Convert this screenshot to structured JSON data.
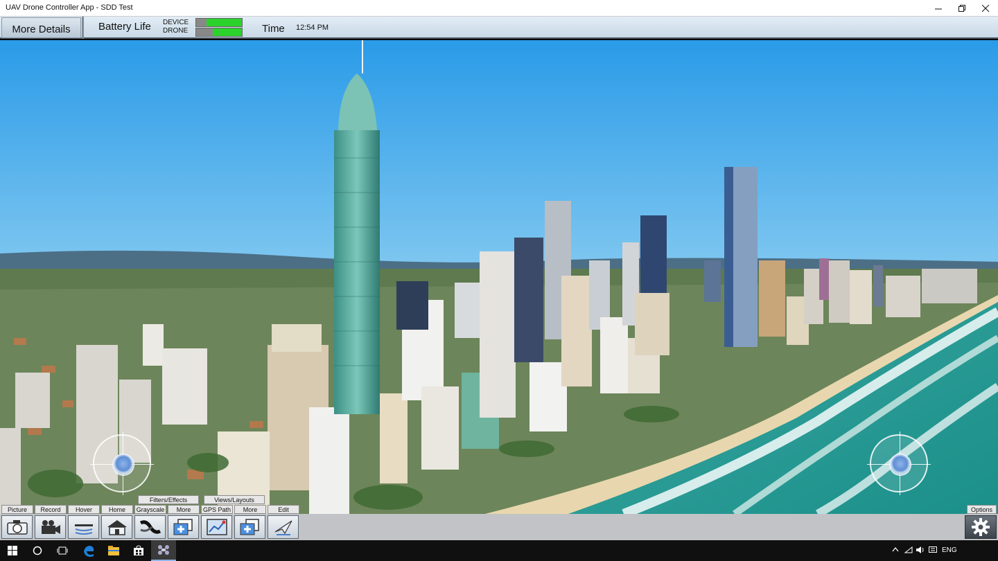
{
  "window": {
    "title": "UAV Drone Controller App - SDD Test"
  },
  "info_bar": {
    "more_details": "More Details",
    "battery_label": "Battery Life",
    "device_label": "DEVICE",
    "drone_label": "DRONE",
    "device_battery": 0.78,
    "drone_battery": 0.63,
    "time_label": "Time",
    "time_value": "12:54 PM"
  },
  "toolbar": {
    "labels": [
      "Picture",
      "Record",
      "Hover",
      "Home",
      "Grayscale",
      "More",
      "GPS Path",
      "More",
      "Edit"
    ],
    "groups": [
      "Filters/Effects",
      "Views/Layouts"
    ],
    "options": "Options",
    "icons": [
      "camera-icon",
      "video-camera-icon",
      "hover-icon",
      "home-icon",
      "grayscale-icon",
      "filter-add-icon",
      "gps-path-icon",
      "layout-add-icon",
      "edit-plane-icon",
      "gear-icon"
    ]
  },
  "taskbar": {
    "language": "ENG",
    "icons": [
      "windows-start-icon",
      "search-circle-icon",
      "task-view-icon",
      "edge-icon",
      "file-explorer-icon",
      "store-icon",
      "drone-app-icon"
    ]
  }
}
